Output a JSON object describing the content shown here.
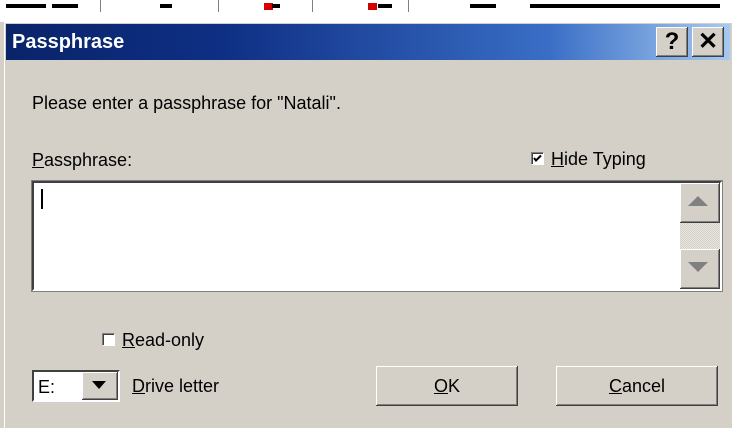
{
  "dialog": {
    "title": "Passphrase",
    "help_glyph": "?",
    "close_glyph": "✕",
    "prompt": "Please enter a passphrase for \"Natali\".",
    "passphrase_label": {
      "accel": "P",
      "rest": "assphrase:"
    },
    "hide_typing": {
      "accel": "H",
      "rest": "ide Typing",
      "checked": true
    },
    "passphrase_value": "",
    "read_only": {
      "accel": "R",
      "rest": "ead-only",
      "checked": false
    },
    "drive": {
      "value": "E:",
      "label_accel": "D",
      "label_rest": "rive letter"
    },
    "ok_button": {
      "accel": "O",
      "rest": "K"
    },
    "cancel_button": {
      "accel": "C",
      "rest": "ancel"
    }
  },
  "icons": {
    "titlebar": [
      "help-icon",
      "close-icon"
    ],
    "scrollbar": [
      "arrow-up-icon",
      "arrow-down-icon"
    ],
    "combo": "dropdown-arrow-icon",
    "checkbox": "checkmark-icon"
  },
  "colors": {
    "titlebar_start": "#0a246a",
    "titlebar_end": "#a6caf0",
    "face": "#d4d0c8",
    "title_text": "#ffffff"
  }
}
